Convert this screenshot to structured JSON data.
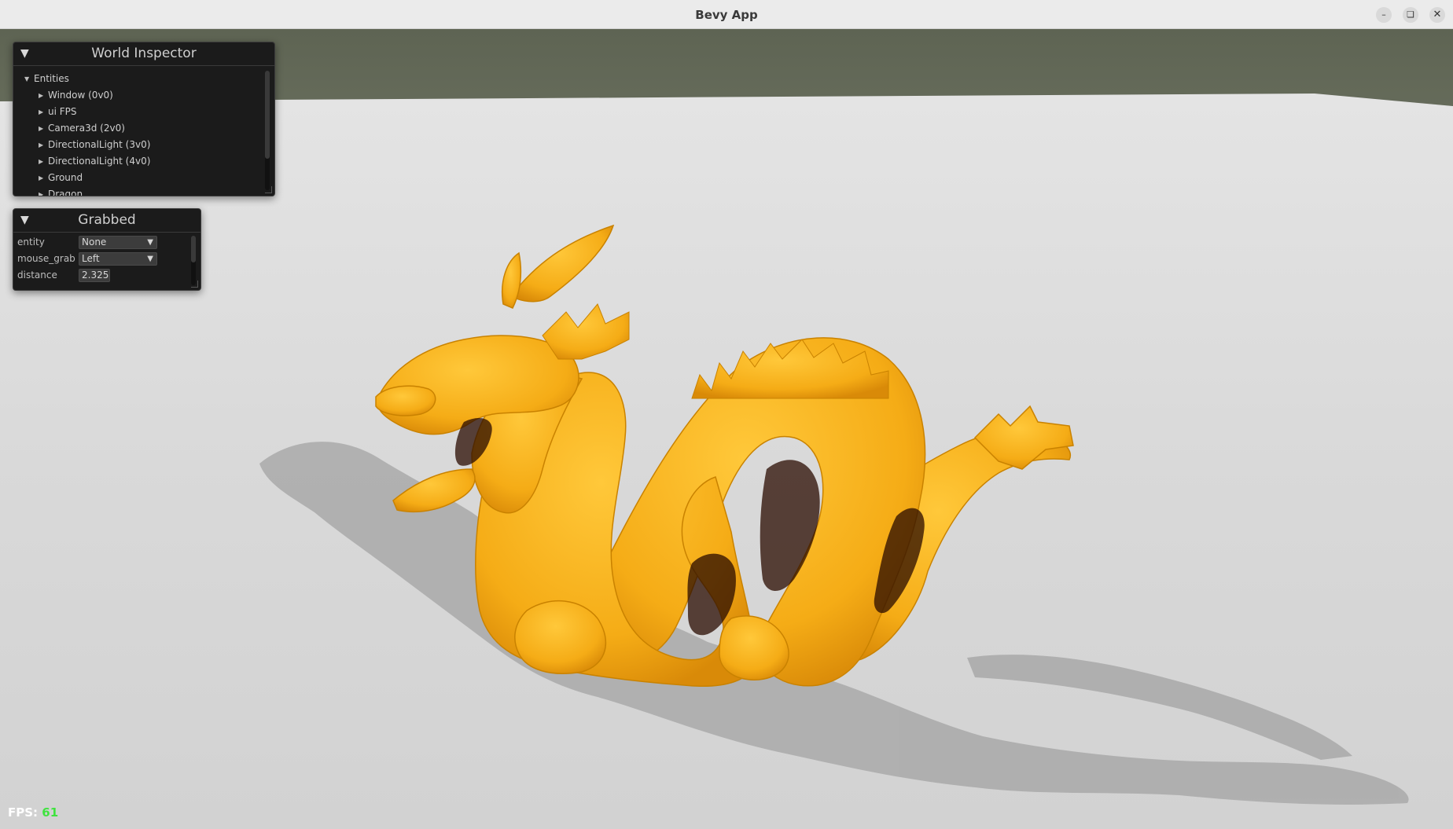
{
  "window": {
    "title": "Bevy App",
    "buttons": {
      "minimize_icon": "minimize-icon",
      "maximize_icon": "maximize-icon",
      "close_icon": "close-icon"
    }
  },
  "world_inspector": {
    "title": "World Inspector",
    "entities_label": "Entities",
    "entities": [
      "Window (0v0)",
      "ui FPS",
      "Camera3d (2v0)",
      "DirectionalLight (3v0)",
      "DirectionalLight (4v0)",
      "Ground",
      "Dragon"
    ]
  },
  "grabbed": {
    "title": "Grabbed",
    "fields": {
      "entity_label": "entity",
      "entity_value": "None",
      "mouse_grab_label": "mouse_grab",
      "mouse_grab_value": "Left",
      "distance_label": "distance",
      "distance_value": "2.325"
    }
  },
  "fps": {
    "label": "FPS: ",
    "value": "61"
  },
  "colors": {
    "dragon": "#f5b21c",
    "ground": "#dcdcdc",
    "fps_value": "#3fe33f",
    "panel_bg": "#1b1b1b"
  }
}
